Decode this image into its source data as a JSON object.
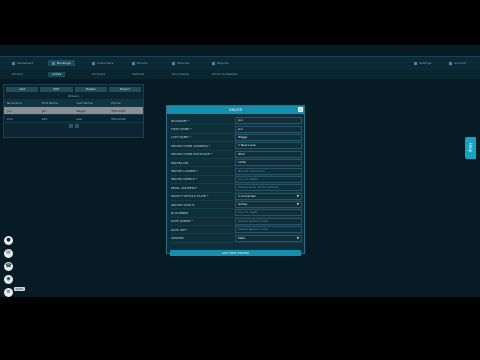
{
  "topnav": {
    "tabs": [
      "Dashboard",
      "Bookings",
      "Customers",
      "Drivers",
      "Vehicles",
      "Reports",
      "Settings",
      "Account"
    ]
  },
  "subnav": {
    "tabs": [
      "Drivers",
      "Active",
      "Archived",
      "Vehicles",
      "Documents",
      "Driver Schedules"
    ]
  },
  "panel": {
    "buttons": [
      "Add",
      "Edit",
      "Delete",
      "Export"
    ],
    "title": "Drivers",
    "headers": [
      "Nickname",
      "First Name",
      "Last Name",
      "Phone"
    ],
    "rows": [
      [
        "Jon",
        "Jon",
        "Wiggs",
        "555-0101"
      ],
      [
        "Kim",
        "Kim",
        "Lee",
        "555-0102"
      ]
    ]
  },
  "help": {
    "label": "Help"
  },
  "dialog": {
    "title": "DRIVER",
    "close": "×",
    "submit": "ADD NEW DRIVER",
    "fields": [
      {
        "label": "NICKNAME *",
        "value": "Jon"
      },
      {
        "label": "FIRST NAME *",
        "value": "Jon"
      },
      {
        "label": "LAST NAME *",
        "value": "Wiggs"
      },
      {
        "label": "DRIVER HOME ADDRESS *",
        "value": "1 New Lane"
      },
      {
        "label": "DRIVER HOME POSTCODE *",
        "value": "W1C"
      },
      {
        "label": "DRIVER PIN",
        "value": "1234"
      },
      {
        "label": "DRIVER LICENSE *",
        "value": "Not #1 maximum"
      },
      {
        "label": "DRIVER MOBILE *",
        "value": "Any 11 digits"
      },
      {
        "label": "EMAIL ADDRESS*",
        "value": "Please enter email address"
      },
      {
        "label": "SELECT VEHICLE PLATE *",
        "value": "1-Computer"
      },
      {
        "label": "DRIVER STATUS",
        "value": "Active"
      },
      {
        "label": "NI NUMBER",
        "value": "Any 11 digits"
      },
      {
        "label": "DATE JOINED *",
        "value": "Please select a date"
      },
      {
        "label": "DATE LEFT",
        "value": "Please select a date"
      },
      {
        "label": "GENDER",
        "value": "Male"
      }
    ]
  },
  "zoom": "100%"
}
